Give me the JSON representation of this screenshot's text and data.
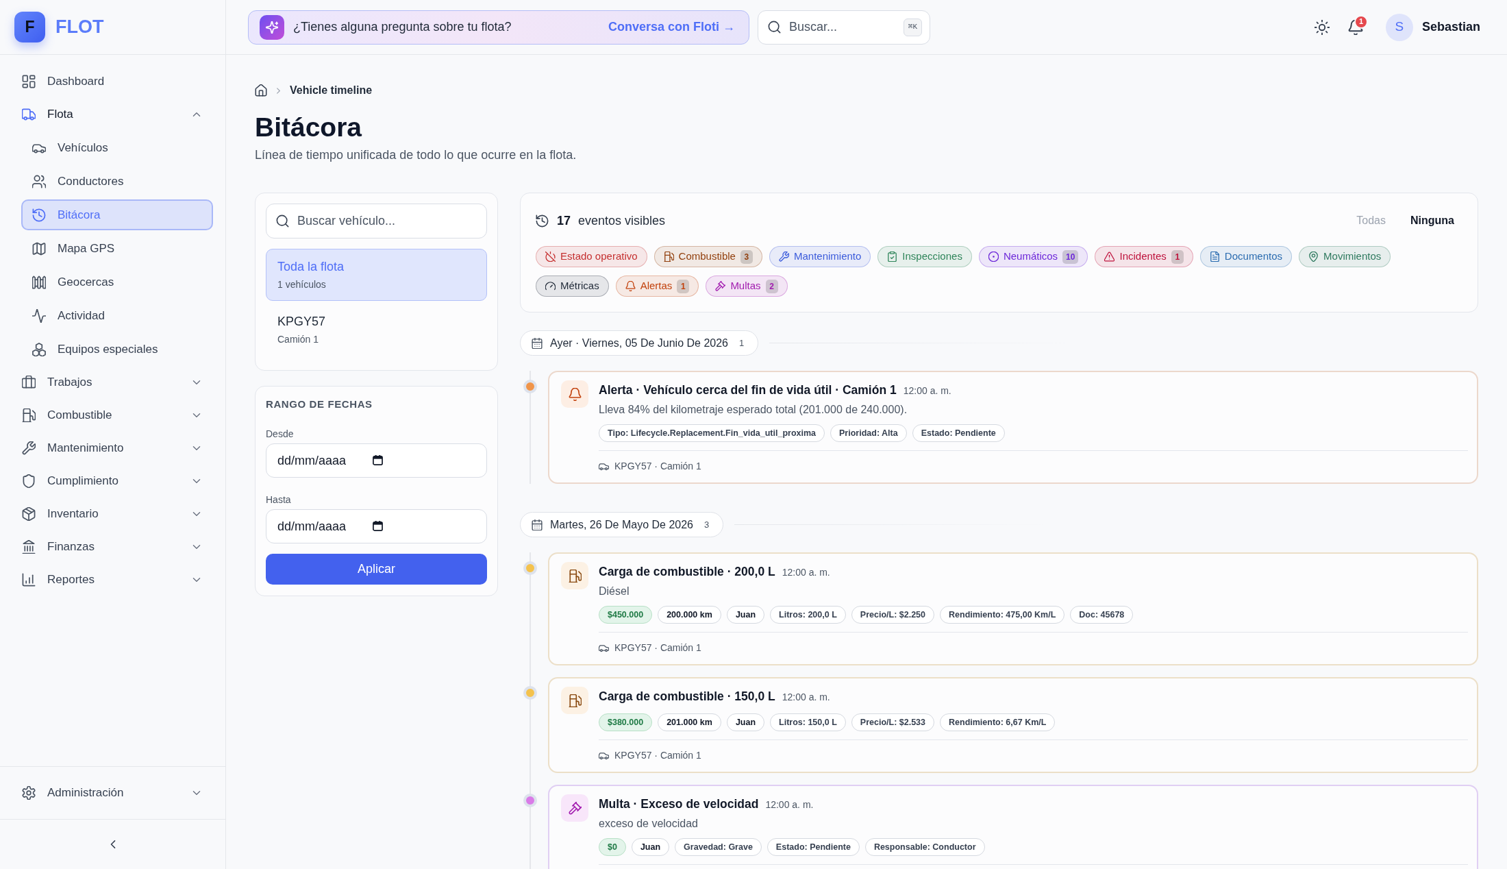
{
  "sidebar": {
    "logo": {
      "letter": "F",
      "name": "FLOT"
    },
    "items": [
      {
        "label": "Dashboard",
        "selected": false
      },
      {
        "label": "Flota",
        "selected": false,
        "expanded": true,
        "children": [
          {
            "label": "Vehículos",
            "selected": false
          },
          {
            "label": "Conductores",
            "selected": false
          },
          {
            "label": "Bitácora",
            "selected": true
          },
          {
            "label": "Mapa GPS",
            "selected": false
          },
          {
            "label": "Geocercas",
            "selected": false
          },
          {
            "label": "Actividad",
            "selected": false
          },
          {
            "label": "Equipos especiales",
            "selected": false
          }
        ]
      },
      {
        "label": "Trabajos",
        "selected": false,
        "expanded": false
      },
      {
        "label": "Combustible",
        "selected": false,
        "expanded": false
      },
      {
        "label": "Mantenimiento",
        "selected": false,
        "expanded": false
      },
      {
        "label": "Cumplimiento",
        "selected": false,
        "expanded": false
      },
      {
        "label": "Inventario",
        "selected": false,
        "expanded": false
      },
      {
        "label": "Finanzas",
        "selected": false,
        "expanded": false
      },
      {
        "label": "Reportes",
        "selected": false,
        "expanded": false
      }
    ],
    "footer_item": {
      "label": "Administración",
      "expanded": false
    }
  },
  "top_bar": {
    "assistant_banner": {
      "text": "¿Tienes alguna pregunta sobre tu flota?",
      "link": "Conversa con Floti →"
    },
    "search": {
      "placeholder": "Buscar...",
      "shortcut": "⌘K"
    },
    "notifications": {
      "count": "1"
    },
    "user": {
      "initial": "S",
      "name": "Sebastian"
    }
  },
  "breadcrumb": {
    "current": "Vehicle timeline"
  },
  "page": {
    "title": "Bitácora",
    "subtitle": "Línea de tiempo unificada de todo lo que ocurre en la flota."
  },
  "vehicle_panel": {
    "search": {
      "placeholder": "Buscar vehículo..."
    },
    "vehicles": [
      {
        "title": "Toda la flota",
        "subtitle": "1 vehículos",
        "selected": true
      },
      {
        "title": "KPGY57",
        "subtitle": "Camión 1",
        "selected": false
      }
    ]
  },
  "date_range": {
    "title": "RANGO DE FECHAS",
    "fields": [
      {
        "label": "Desde",
        "placeholder": "dd/mm/aaaa"
      },
      {
        "label": "Hasta",
        "placeholder": "dd/mm/aaaa"
      }
    ],
    "apply_button": "Aplicar"
  },
  "filters": {
    "count": "17",
    "count_label": "eventos visibles",
    "actions": [
      {
        "label": "Todas",
        "disabled": true
      },
      {
        "label": "Ninguna",
        "disabled": false
      }
    ],
    "chips": [
      {
        "label": "Estado operativo",
        "color": "#c53030",
        "on": true
      },
      {
        "label": "Combustible",
        "color": "#92400e",
        "count": "3",
        "on": true
      },
      {
        "label": "Mantenimiento",
        "color": "#3b5bdb",
        "on": true
      },
      {
        "label": "Inspecciones",
        "color": "#2f855a",
        "on": true
      },
      {
        "label": "Neumáticos",
        "color": "#6d28d9",
        "count": "10",
        "on": true
      },
      {
        "label": "Incidentes",
        "color": "#be123c",
        "count": "1",
        "on": true
      },
      {
        "label": "Documentos",
        "color": "#2b6cb0",
        "on": true
      },
      {
        "label": "Movimientos",
        "color": "#2f7a5f",
        "on": true
      },
      {
        "label": "Métricas",
        "color": "#1f2937",
        "on": true
      },
      {
        "label": "Alertas",
        "color": "#c2410c",
        "count": "1",
        "on": true
      },
      {
        "label": "Multas",
        "color": "#a21caf",
        "count": "2",
        "on": true
      }
    ]
  },
  "timeline": [
    {
      "date": "Ayer · Viernes, 05 De Junio De 2026",
      "count": "1",
      "events": [
        {
          "kind": "alert",
          "color": "#f0954a",
          "title": "Alerta · Vehículo cerca del fin de vida útil · Camión 1",
          "time": "12:00 a. m.",
          "description": "Lleva 84% del kilometraje esperado total (201.000 de 240.000).",
          "tags": [
            {
              "text": "Tipo: Lifecycle.Replacement.Fin_vida_util_proxima",
              "kind": "field"
            },
            {
              "text": "Prioridad: Alta",
              "kind": "field"
            },
            {
              "text": "Estado: Pendiente",
              "kind": "field"
            }
          ],
          "vehicle": "KPGY57 · Camión 1"
        }
      ]
    },
    {
      "date": "Martes, 26 De Mayo De 2026",
      "count": "3",
      "events": [
        {
          "kind": "fuel",
          "color": "#f4c24d",
          "title": "Carga de combustible · 200,0 L",
          "time": "12:00 a. m.",
          "description": "Diésel",
          "tags": [
            {
              "text": "$450.000",
              "kind": "amount"
            },
            {
              "text": "200.000 km",
              "kind": "plain"
            },
            {
              "text": "Juan",
              "kind": "plain"
            },
            {
              "text": "Litros: 200,0 L",
              "kind": "field"
            },
            {
              "text": "Precio/L: $2.250",
              "kind": "field"
            },
            {
              "text": "Rendimiento: 475,00 Km/L",
              "kind": "field"
            },
            {
              "text": "Doc: 45678",
              "kind": "field"
            }
          ],
          "vehicle": "KPGY57 · Camión 1"
        },
        {
          "kind": "fuel",
          "color": "#f4c24d",
          "title": "Carga de combustible · 150,0 L",
          "time": "12:00 a. m.",
          "tags": [
            {
              "text": "$380.000",
              "kind": "amount"
            },
            {
              "text": "201.000 km",
              "kind": "plain"
            },
            {
              "text": "Juan",
              "kind": "plain"
            },
            {
              "text": "Litros: 150,0 L",
              "kind": "field"
            },
            {
              "text": "Precio/L: $2.533",
              "kind": "field"
            },
            {
              "text": "Rendimiento: 6,67 Km/L",
              "kind": "field"
            }
          ],
          "vehicle": "KPGY57 · Camión 1"
        },
        {
          "kind": "fine",
          "color": "#d97be8",
          "title": "Multa · Exceso de velocidad",
          "time": "12:00 a. m.",
          "description": "exceso de velocidad",
          "tags": [
            {
              "text": "$0",
              "kind": "amount"
            },
            {
              "text": "Juan",
              "kind": "plain"
            },
            {
              "text": "Gravedad: Grave",
              "kind": "field"
            },
            {
              "text": "Estado: Pendiente",
              "kind": "field"
            },
            {
              "text": "Responsable: Conductor",
              "kind": "field"
            }
          ]
        }
      ]
    }
  ]
}
